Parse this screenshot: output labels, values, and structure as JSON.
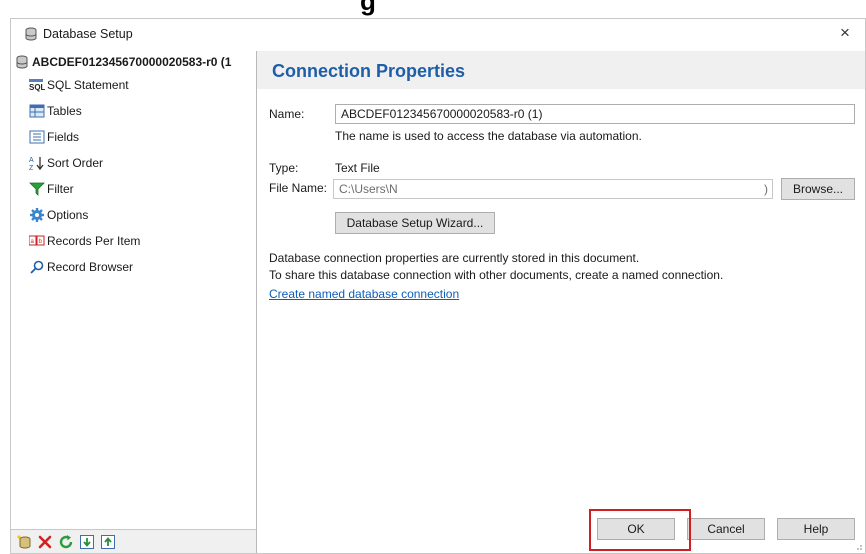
{
  "page_heading": "g",
  "window": {
    "title": "Database Setup",
    "close_label": "×"
  },
  "sidebar": {
    "root_label": "ABCDEF012345670000020583-r0 (1",
    "items": [
      {
        "label": "SQL Statement",
        "icon": "sql-icon"
      },
      {
        "label": "Tables",
        "icon": "tables-icon"
      },
      {
        "label": "Fields",
        "icon": "fields-icon"
      },
      {
        "label": "Sort Order",
        "icon": "sort-order-icon"
      },
      {
        "label": "Filter",
        "icon": "filter-icon"
      },
      {
        "label": "Options",
        "icon": "options-gear-icon"
      },
      {
        "label": "Records Per Item",
        "icon": "records-per-item-icon"
      },
      {
        "label": "Record Browser",
        "icon": "search-icon"
      }
    ],
    "toolbar": [
      "add-database-icon",
      "delete-icon",
      "refresh-icon",
      "move-down-icon",
      "move-up-icon"
    ]
  },
  "content": {
    "title": "Connection Properties",
    "name_label": "Name:",
    "name_value": "ABCDEF012345670000020583-r0 (1)",
    "name_hint": "The name is used to access the database via automation.",
    "type_label": "Type:",
    "type_value": "Text File",
    "file_name_label": "File Name:",
    "file_name_value": "C:\\Users\\N",
    "file_name_tail": ")",
    "browse_button": "Browse...",
    "wizard_button": "Database Setup Wizard...",
    "info_line1": "Database connection properties are currently stored in this document.",
    "info_line2": "To share this database connection with other documents, create a named connection.",
    "create_link": "Create named database connection"
  },
  "footer": {
    "ok": "OK",
    "cancel": "Cancel",
    "help": "Help"
  },
  "colors": {
    "title_blue": "#1e5ea8",
    "link_blue": "#0d5eb8",
    "highlight_red": "#d21e1e"
  }
}
